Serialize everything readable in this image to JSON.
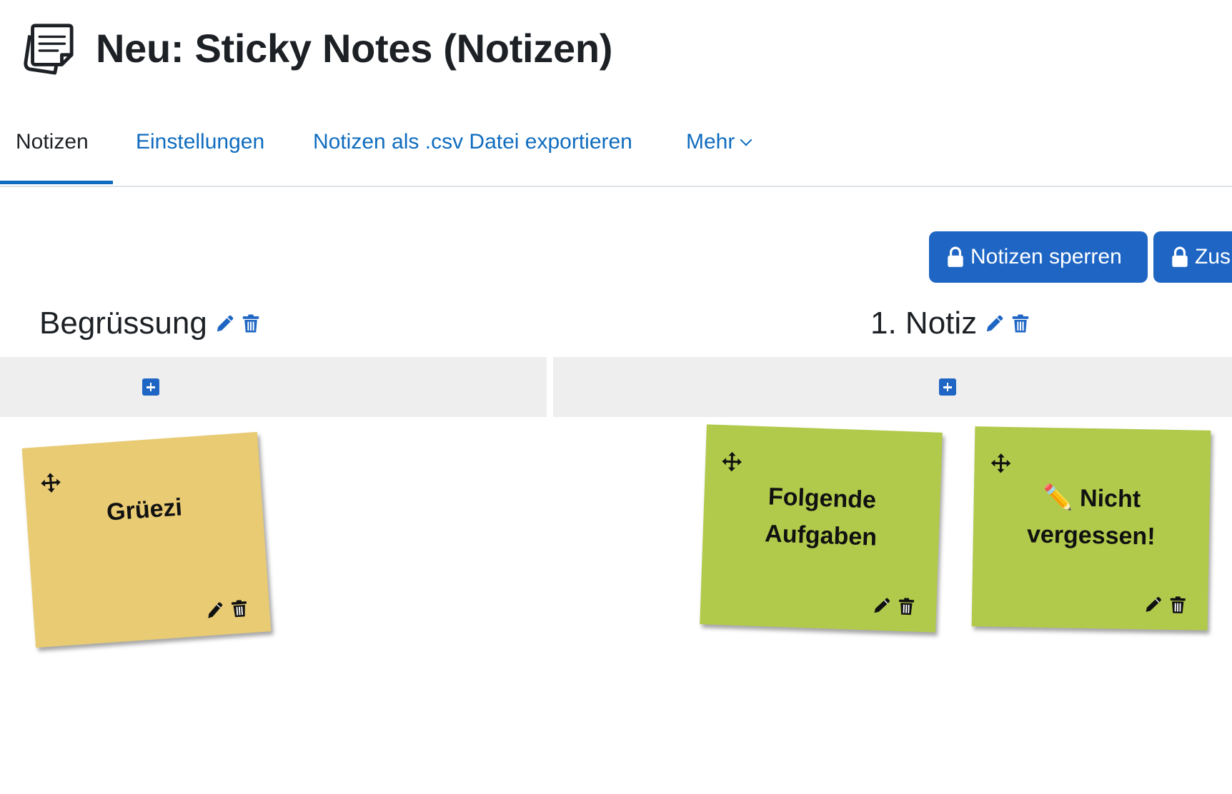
{
  "page": {
    "title": "Neu: Sticky Notes (Notizen)",
    "icon": "sticky-notes-icon"
  },
  "tabs": [
    {
      "label": "Notizen",
      "active": true
    },
    {
      "label": "Einstellungen",
      "active": false
    },
    {
      "label": "Notizen als .csv Datei exportieren",
      "active": false
    },
    {
      "label": "Mehr",
      "active": false
    }
  ],
  "actions": {
    "lock_notes_label": "Notizen sperren",
    "second_button_label": "Zus"
  },
  "columns": [
    {
      "title": "Begrüssung",
      "notes": [
        {
          "text": "Grüezi",
          "color": "#e8cb73"
        }
      ]
    },
    {
      "title": "1. Notiz",
      "notes": [
        {
          "text": "Folgende Aufgaben",
          "color": "#b1ca4b"
        },
        {
          "text": "✏️ Nicht vergessen!",
          "color": "#b1ca4b"
        }
      ]
    }
  ],
  "colors": {
    "accent": "#1f66c4",
    "link": "#0f6cbf",
    "addbar": "#eeeeee"
  }
}
